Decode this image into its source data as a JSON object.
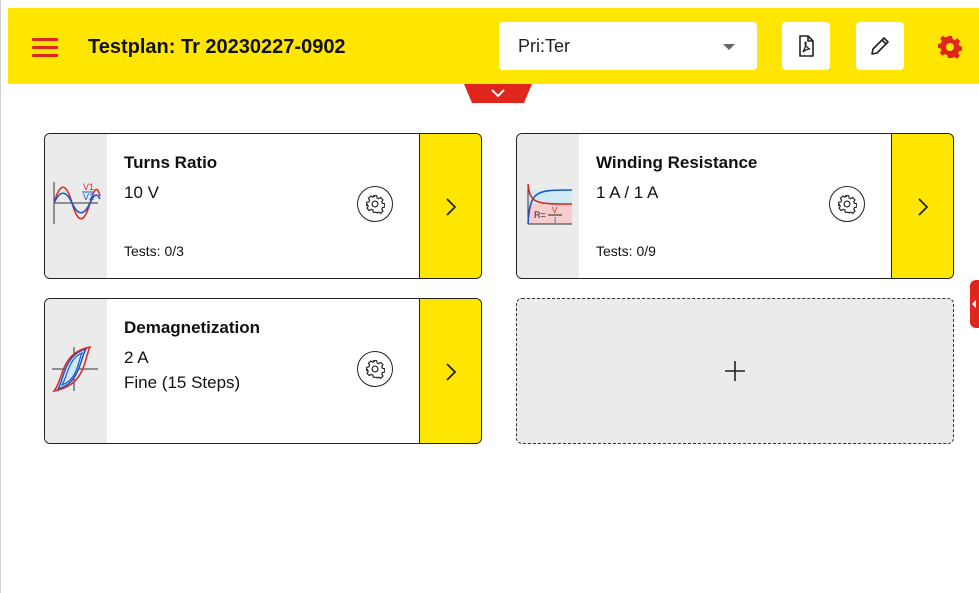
{
  "header": {
    "title": "Testplan: Tr 20230227-0902",
    "dropdown_value": "Pri:Ter",
    "menu_icon": "hamburger-menu-icon",
    "pdf_icon": "pdf-icon",
    "edit_icon": "pencil-icon",
    "settings_icon": "gear-icon"
  },
  "colors": {
    "header_bg": "#ffe600",
    "accent_red": "#e0261c",
    "thumb_bg": "#ebebeb"
  },
  "cards": [
    {
      "name": "Turns Ratio",
      "line1": "10 V",
      "line2": "",
      "tests": "Tests: 0/3",
      "icon": "turns-ratio-waveform-icon"
    },
    {
      "name": "Winding Resistance",
      "line1": "1 A / 1 A",
      "line2": "",
      "tests": "Tests: 0/9",
      "icon": "winding-resistance-curve-icon"
    },
    {
      "name": "Demagnetization",
      "line1": "2 A",
      "line2": "Fine (15 Steps)",
      "tests": "",
      "icon": "hysteresis-loop-icon"
    }
  ],
  "add_card": {
    "icon": "plus-icon"
  }
}
